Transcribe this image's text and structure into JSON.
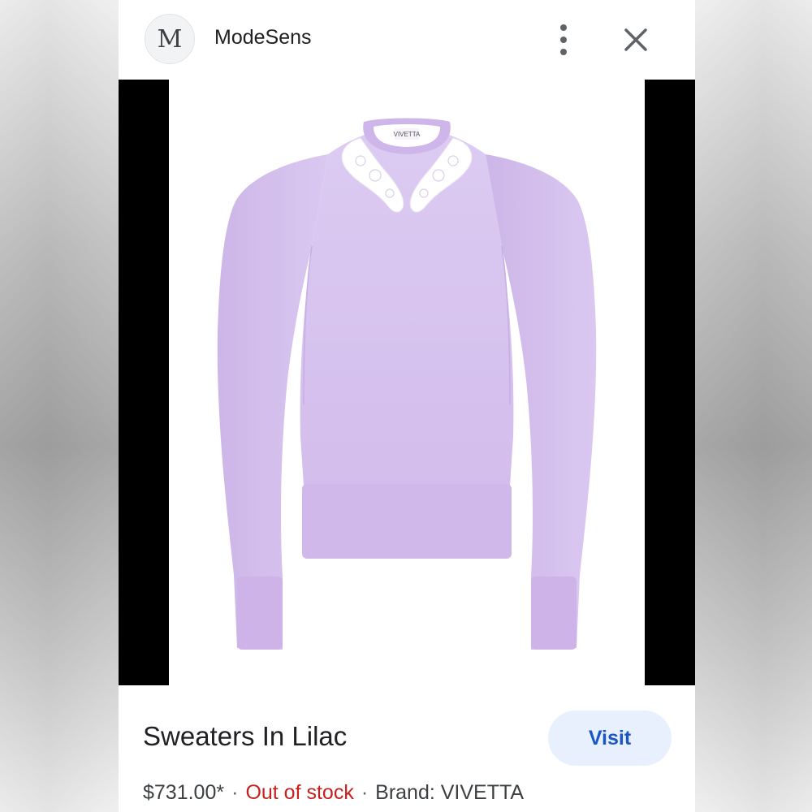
{
  "header": {
    "logo_letter": "M",
    "site_name": "ModeSens",
    "more_icon": "more-vert-icon",
    "close_icon": "close-icon"
  },
  "product": {
    "image_alt": "Lilac sweater with white lace collar",
    "title": "Sweaters In Lilac",
    "visit_label": "Visit",
    "price": "$731.00*",
    "separator": "·",
    "stock_status": "Out of stock",
    "brand": "Brand: VIVETTA",
    "label_text": "VIVETTA"
  },
  "colors": {
    "accent": "#1a56c4",
    "visit_bg": "#e8f0fe",
    "stock_red": "#c5221f",
    "sweater": "#d9c6f0"
  }
}
